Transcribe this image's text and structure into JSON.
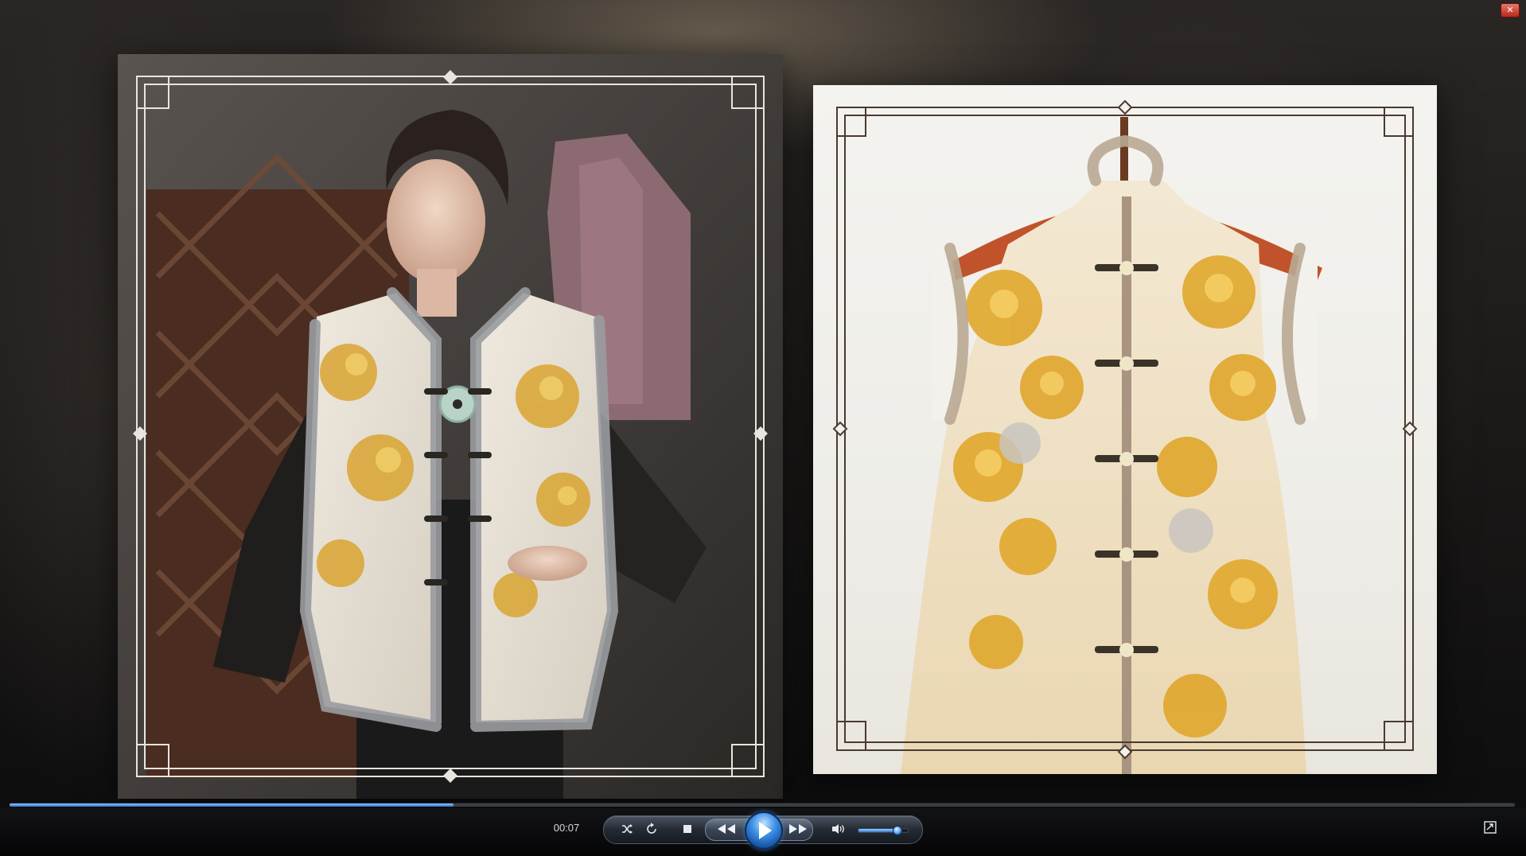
{
  "window": {
    "close_label": "✕"
  },
  "photos": {
    "left": {
      "name": "model-wearing-vest-photo"
    },
    "right": {
      "name": "vest-on-hanger-photo"
    }
  },
  "player": {
    "elapsed": "00:07",
    "progress_fraction": 0.295,
    "volume_fraction": 0.78,
    "icons": {
      "shuffle": "shuffle-icon",
      "repeat": "repeat-icon",
      "stop": "stop-icon",
      "previous": "rewind-icon",
      "play": "play-icon",
      "next": "fast-forward-icon",
      "mute": "speaker-icon",
      "switch_mode": "switch-to-library-icon"
    }
  },
  "colors": {
    "accent_blue": "#2f6fcf",
    "frame_line_left": "#e6e2dc",
    "frame_line_right": "#4a3a30",
    "vest_gold": "#e0a72c"
  }
}
